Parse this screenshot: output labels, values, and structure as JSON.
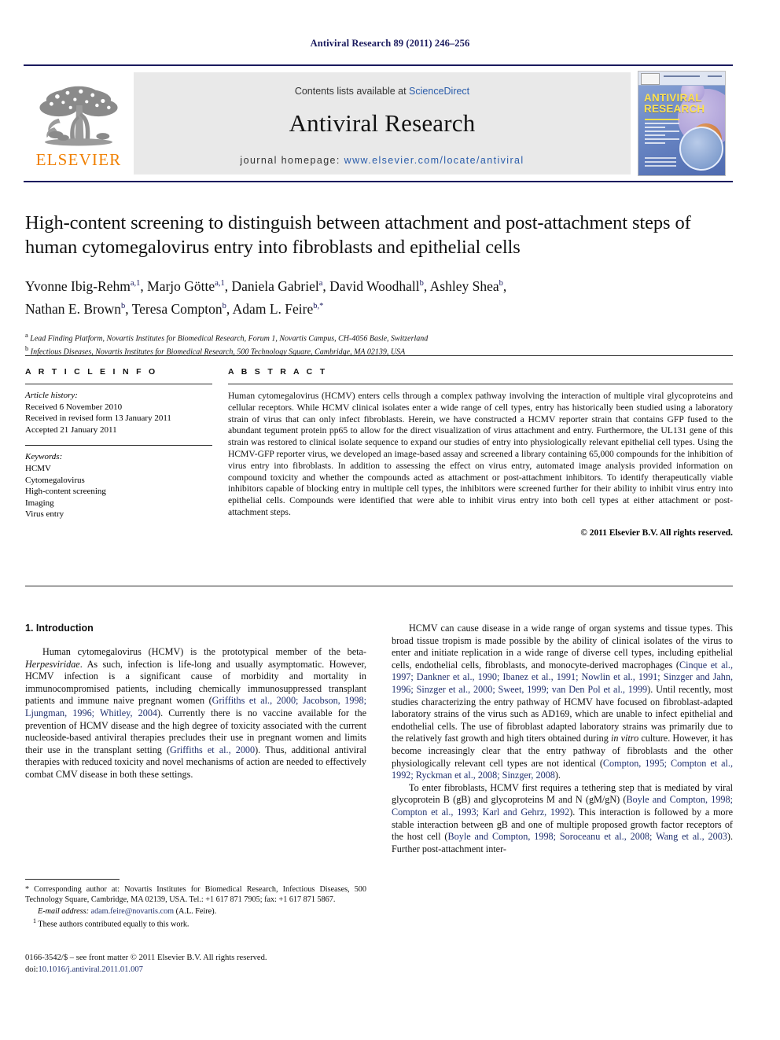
{
  "running_head": "Antiviral Research 89 (2011) 246–256",
  "masthead": {
    "publisher_name": "ELSEVIER",
    "contents_prefix": "Contents lists available at ",
    "contents_link": "ScienceDirect",
    "journal_title": "Antiviral Research",
    "homepage_label": "journal homepage: ",
    "homepage_url": "www.elsevier.com/locate/antiviral",
    "cover_title_line1": "ANTIVIRAL",
    "cover_title_line2": "RESEARCH"
  },
  "article": {
    "title": "High-content screening to distinguish between attachment and post-attachment steps of human cytomegalovirus entry into fibroblasts and epithelial cells",
    "authors": [
      {
        "name": "Yvonne Ibig-Rehm",
        "sup": "a,1"
      },
      {
        "name": "Marjo Götte",
        "sup": "a,1"
      },
      {
        "name": "Daniela Gabriel",
        "sup": "a"
      },
      {
        "name": "David Woodhall",
        "sup": "b"
      },
      {
        "name": "Ashley Shea",
        "sup": "b"
      },
      {
        "name": "Nathan E. Brown",
        "sup": "b"
      },
      {
        "name": "Teresa Compton",
        "sup": "b"
      },
      {
        "name": "Adam L. Feire",
        "sup": "b,*"
      }
    ],
    "affiliations": [
      {
        "marker": "a",
        "text": "Lead Finding Platform, Novartis Institutes for Biomedical Research, Forum 1, Novartis Campus, CH-4056 Basle, Switzerland"
      },
      {
        "marker": "b",
        "text": "Infectious Diseases, Novartis Institutes for Biomedical Research, 500 Technology Square, Cambridge, MA 02139, USA"
      }
    ]
  },
  "article_info": {
    "heading": "A R T I C L E    I N F O",
    "history_label": "Article history:",
    "history": [
      "Received 6 November 2010",
      "Received in revised form 13 January 2011",
      "Accepted 21 January 2011"
    ],
    "keywords_label": "Keywords:",
    "keywords": [
      "HCMV",
      "Cytomegalovirus",
      "High-content screening",
      "Imaging",
      "Virus entry"
    ]
  },
  "abstract": {
    "heading": "A B S T R A C T",
    "text": "Human cytomegalovirus (HCMV) enters cells through a complex pathway involving the interaction of multiple viral glycoproteins and cellular receptors. While HCMV clinical isolates enter a wide range of cell types, entry has historically been studied using a laboratory strain of virus that can only infect fibroblasts. Herein, we have constructed a HCMV reporter strain that contains GFP fused to the abundant tegument protein pp65 to allow for the direct visualization of virus attachment and entry. Furthermore, the UL131 gene of this strain was restored to clinical isolate sequence to expand our studies of entry into physiologically relevant epithelial cell types. Using the HCMV-GFP reporter virus, we developed an image-based assay and screened a library containing 65,000 compounds for the inhibition of virus entry into fibroblasts. In addition to assessing the effect on virus entry, automated image analysis provided information on compound toxicity and whether the compounds acted as attachment or post-attachment inhibitors. To identify therapeutically viable inhibitors capable of blocking entry in multiple cell types, the inhibitors were screened further for their ability to inhibit virus entry into epithelial cells. Compounds were identified that were able to inhibit virus entry into both cell types at either attachment or post-attachment steps.",
    "copyright": "© 2011 Elsevier B.V. All rights reserved."
  },
  "introduction": {
    "heading": "1.  Introduction",
    "left_paragraph_1": "Human cytomegalovirus (HCMV) is the prototypical member of the beta-",
    "left_paragraph_1_italic": "Herpesviridae",
    "left_paragraph_1_cont": ". As such, infection is life-long and usually asymptomatic. However, HCMV infection is a significant cause of morbidity and mortality in immunocompromised patients, including chemically immunosuppressed transplant patients and immune naive pregnant women (",
    "left_ref_1": "Griffiths et al., 2000; Jacobson, 1998; Ljungman, 1996; Whitley, 2004",
    "left_paragraph_1_cont2": "). Currently there is no vaccine available for the prevention of HCMV disease and the high degree of toxicity associated with the current nucleoside-based antiviral therapies precludes their use in pregnant women and limits their use in the transplant setting (",
    "left_ref_2": "Griffiths et al., 2000",
    "left_paragraph_1_cont3": "). Thus, additional antiviral therapies with reduced toxicity and novel mechanisms of action are needed to effectively combat CMV disease in both these settings.",
    "right_paragraph_1_a": "HCMV can cause disease in a wide range of organ systems and tissue types. This broad tissue tropism is made possible by the ability of clinical isolates of the virus to enter and initiate replication in a wide range of diverse cell types, including epithelial cells, endothelial cells, fibroblasts, and monocyte-derived macrophages (",
    "right_ref_1": "Cinque et al., 1997; Dankner et al., 1990; Ibanez et al., 1991; Nowlin et al., 1991; Sinzger and Jahn, 1996; Sinzger et al., 2000; Sweet, 1999; van Den Pol et al., 1999",
    "right_paragraph_1_b": "). Until recently, most studies characterizing the entry pathway of HCMV have focused on fibroblast-adapted laboratory strains of the virus such as AD169, which are unable to infect epithelial and endothelial cells. The use of fibroblast adapted laboratory strains was primarily due to the relatively fast growth and high titers obtained during ",
    "right_italic_1": "in vitro",
    "right_paragraph_1_c": " culture. However, it has become increasingly clear that the entry pathway of fibroblasts and the other physiologically relevant cell types are not identical (",
    "right_ref_2": "Compton, 1995; Compton et al., 1992; Ryckman et al., 2008; Sinzger, 2008",
    "right_paragraph_1_d": ").",
    "right_paragraph_2_a": "To enter fibroblasts, HCMV first requires a tethering step that is mediated by viral glycoprotein B (gB) and glycoproteins M and N (gM/gN) (",
    "right_ref_3": "Boyle and Compton, 1998; Compton et al., 1993; Karl and Gehrz, 1992",
    "right_paragraph_2_b": "). This interaction is followed by a more stable interaction between gB and one of multiple proposed growth factor receptors of the host cell (",
    "right_ref_4": "Boyle and Compton, 1998; Soroceanu et al., 2008; Wang et al., 2003",
    "right_paragraph_2_c": "). Further post-attachment inter-"
  },
  "footnotes": {
    "corresponding": "* Corresponding author at: Novartis Institutes for Biomedical Research, Infectious Diseases, 500 Technology Square, Cambridge, MA 02139, USA. Tel.: +1 617 871 7905; fax: +1 617 871 5867.",
    "email_label": "E-mail address:",
    "email": "adam.feire@novartis.com",
    "email_suffix": "(A.L. Feire).",
    "equal_contrib_marker": "1",
    "equal_contrib": "These authors contributed equally to this work."
  },
  "imprint": {
    "line1": "0166-3542/$ – see front matter © 2011 Elsevier B.V. All rights reserved.",
    "doi_label": "doi:",
    "doi": "10.1016/j.antiviral.2011.01.007"
  },
  "colors": {
    "header_blue": "#1a1a5e",
    "ref_blue": "#20306e",
    "link_blue": "#2a5caa",
    "elsevier_orange": "#f08000",
    "band_gray": "#e9e9e9"
  }
}
